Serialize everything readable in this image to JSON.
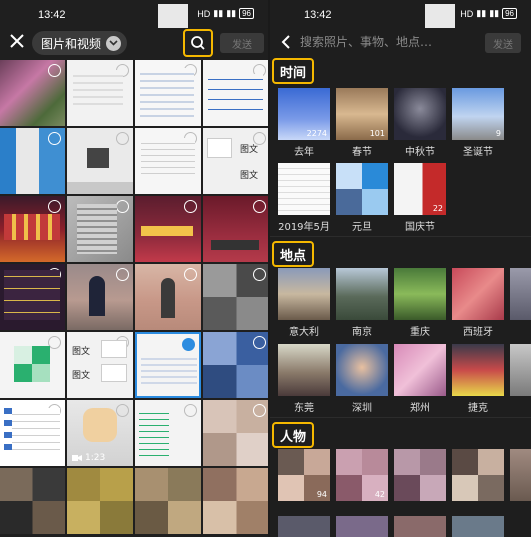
{
  "left": {
    "status": {
      "time": "13:42",
      "net": "HD",
      "battery": "96"
    },
    "header": {
      "album_label": "图片和视频",
      "send_label": "发送"
    },
    "grid_text": {
      "row2_c4a": "图文",
      "row2_c4b": "图文",
      "row3_c4": "图文",
      "row5_c2a": "图文",
      "row5_c2b": "图文",
      "video_duration": "1:23"
    }
  },
  "right": {
    "status": {
      "time": "13:42",
      "net": "HD",
      "battery": "96"
    },
    "header": {
      "search_placeholder": "搜索照片、事物、地点…",
      "send_label": "发送"
    },
    "sections": [
      {
        "title": "时间",
        "items": [
          {
            "label": "去年",
            "count": "2274"
          },
          {
            "label": "春节",
            "count": "101"
          },
          {
            "label": "中秋节",
            "count": ""
          },
          {
            "label": "圣诞节",
            "count": "9"
          },
          {
            "label": "2019年5月",
            "count": ""
          },
          {
            "label": "元旦",
            "count": ""
          },
          {
            "label": "国庆节",
            "count": "22"
          }
        ]
      },
      {
        "title": "地点",
        "items": [
          {
            "label": "意大利"
          },
          {
            "label": "南京"
          },
          {
            "label": "重庆"
          },
          {
            "label": "西班牙"
          },
          {
            "label": "东莞"
          },
          {
            "label": "深圳"
          },
          {
            "label": "郑州"
          },
          {
            "label": "捷克"
          }
        ]
      },
      {
        "title": "人物",
        "items": [
          {
            "count": "94"
          },
          {
            "count": "42"
          },
          {
            "count": ""
          },
          {
            "count": ""
          }
        ]
      }
    ]
  },
  "colors": {
    "accent": "#f5b800",
    "background": "#1e1e1e"
  }
}
